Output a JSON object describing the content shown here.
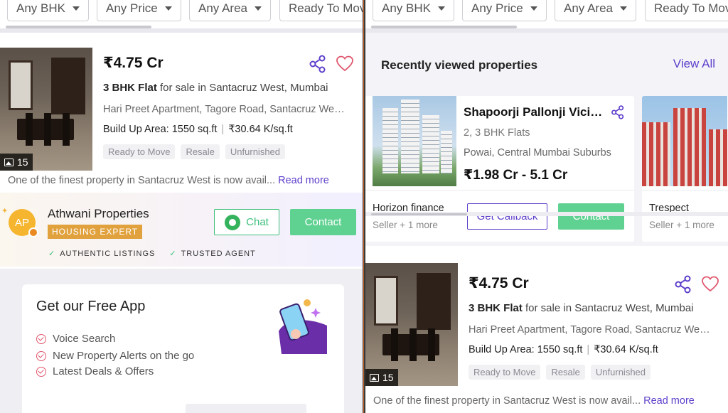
{
  "filters": [
    "Any BHK",
    "Any Price",
    "Any Area",
    "Ready To Move"
  ],
  "property": {
    "price": "₹4.75 Cr",
    "bhk": "3 BHK Flat",
    "title_rest": " for sale in Santacruz West, Mumbai",
    "address": "Hari Preet Apartment, Tagore Road, Santacruz West, Mumbai",
    "area": "Build Up Area: 1550 sq.ft",
    "rate": "₹30.64 K/sq.ft",
    "photo_count": "15",
    "tags": [
      "Ready to Move",
      "Resale",
      "Unfurnished"
    ],
    "description": "One of the finest property in Santacruz West is now avail...",
    "read_more": "Read more"
  },
  "agent": {
    "initials": "AP",
    "name": "Athwani Properties",
    "badge": "HOUSING EXPERT",
    "chat_label": "Chat",
    "contact_label": "Contact",
    "trust": [
      "AUTHENTIC LISTINGS",
      "TRUSTED AGENT"
    ]
  },
  "app_promo": {
    "title": "Get our Free App",
    "features": [
      "Voice Search",
      "New Property Alerts on the go",
      "Latest Deals & Offers"
    ]
  },
  "recently_viewed": {
    "heading": "Recently viewed properties",
    "view_all": "View All",
    "cards": [
      {
        "name": "Shapoorji Pallonji Vicinia",
        "type": "2, 3 BHK Flats",
        "location": "Powai, Central Mumbai Suburbs",
        "price": "₹1.98 Cr - 5.1 Cr",
        "seller": "Horizon finance",
        "seller_sub": "Seller + 1 more",
        "callback_label": "Get Callback",
        "contact_label": "Contact"
      },
      {
        "seller": "Trespect",
        "seller_sub": "Seller + 1 more"
      }
    ]
  },
  "colors": {
    "accent": "#5e3fcb",
    "contact_green": "#5fd191",
    "badge_gold": "#e1a23e",
    "heart": "#e0576e"
  }
}
